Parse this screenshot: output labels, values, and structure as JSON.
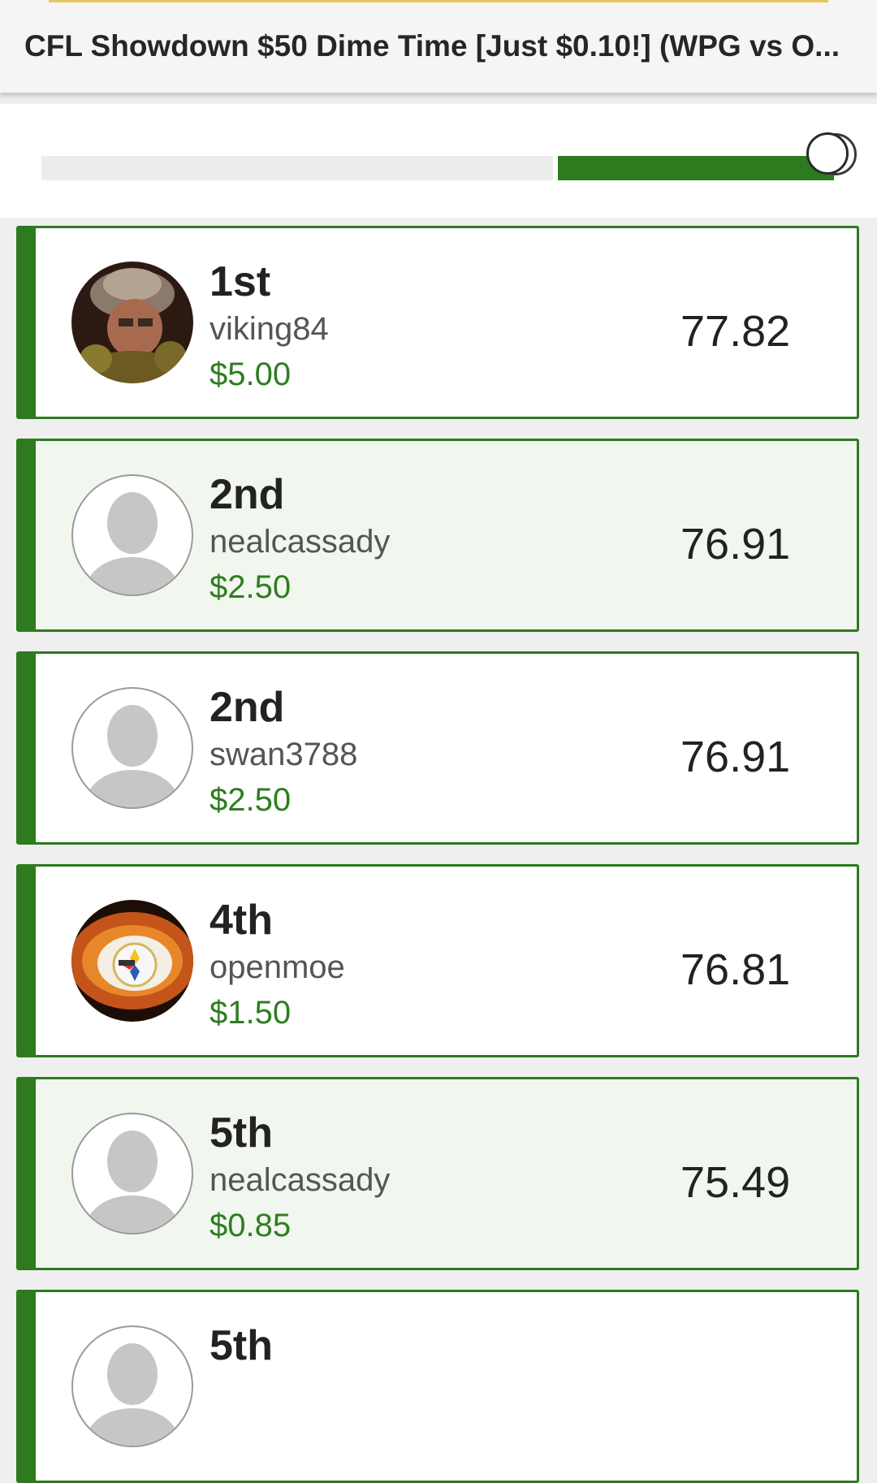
{
  "header": {
    "title": "CFL Showdown $50 Dime Time [Just $0.10!] (WPG vs O..."
  },
  "colors": {
    "accent_green": "#2d7a1f",
    "prize_green": "#2e7d20",
    "header_accent": "#e6c65c"
  },
  "slider": {
    "icon": "slider-thumb"
  },
  "entries": [
    {
      "rank": "1st",
      "username": "viking84",
      "prize": "$5.00",
      "score": "77.82",
      "avatar": "photo-helmet"
    },
    {
      "rank": "2nd",
      "username": "nealcassady",
      "prize": "$2.50",
      "score": "76.91",
      "avatar": "default-person"
    },
    {
      "rank": "2nd",
      "username": "swan3788",
      "prize": "$2.50",
      "score": "76.91",
      "avatar": "default-person"
    },
    {
      "rank": "4th",
      "username": "openmoe",
      "prize": "$1.50",
      "score": "76.81",
      "avatar": "photo-steelers-eye"
    },
    {
      "rank": "5th",
      "username": "nealcassady",
      "prize": "$0.85",
      "score": "75.49",
      "avatar": "default-person"
    },
    {
      "rank": "5th",
      "username": "",
      "prize": "",
      "score": "",
      "avatar": "default-person"
    }
  ]
}
